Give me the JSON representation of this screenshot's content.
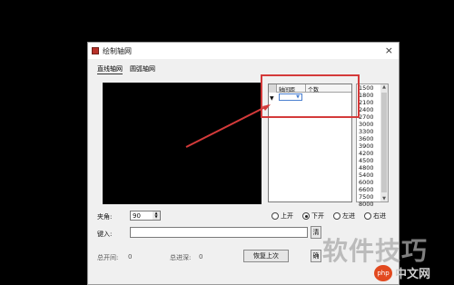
{
  "dialog": {
    "title": "绘制轴网",
    "close": "×"
  },
  "tabs": [
    "直线轴网",
    "圆弧轴网"
  ],
  "grid": {
    "headers": [
      "轴间距",
      "个数"
    ],
    "row_marker": "▼",
    "combo_arrow": "▼"
  },
  "spacing_list": [
    "1500",
    "1800",
    "2100",
    "2400",
    "2700",
    "3000",
    "3300",
    "3600",
    "3900",
    "4200",
    "4500",
    "4800",
    "5400",
    "6000",
    "6600",
    "7500",
    "8000"
  ],
  "scroll": {
    "up": "▲",
    "down": "▼"
  },
  "angle": {
    "label": "夹角:",
    "value": "90",
    "up": "▲",
    "down": "▼"
  },
  "radios": [
    {
      "label": "上开",
      "checked": false
    },
    {
      "label": "下开",
      "checked": true
    },
    {
      "label": "左进",
      "checked": false
    },
    {
      "label": "右进",
      "checked": false
    }
  ],
  "input": {
    "label": "键入:",
    "value": ""
  },
  "buttons": {
    "partial": "清",
    "restore": "恢复上次",
    "confirm": "确"
  },
  "status": {
    "total_open": "总开间:",
    "total_open_value": "0",
    "total_depth": "总进深:",
    "total_depth_value": "0"
  },
  "watermark": {
    "text": "软件技巧",
    "logo": "php",
    "logo_text": "中文网"
  },
  "colors": {
    "annotation": "#d43a3a",
    "background": "#000000"
  }
}
